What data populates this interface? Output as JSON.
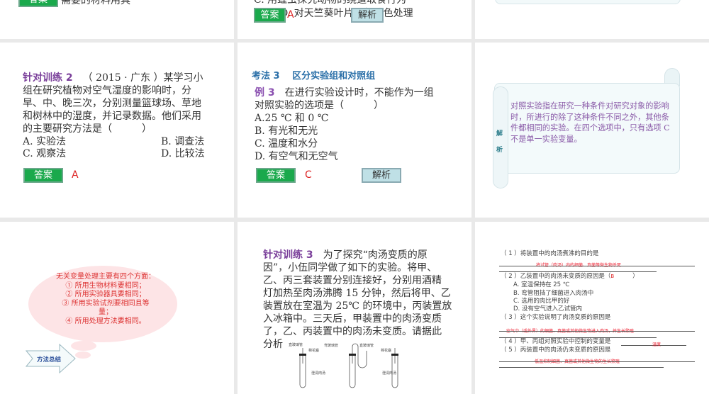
{
  "slides": {
    "s1": {
      "answer_label": "答案",
      "text": "需要的材料用具"
    },
    "s2": {
      "line_c": "C. 用蝗虫探究动物的绕道取食行为",
      "line_d": "D. 对天竺葵叶片进行暗色处理",
      "answer_label": "答案",
      "answer": "A",
      "analysis_label": "解析"
    },
    "s4": {
      "title": "针对训练 2",
      "source": "（ 2015 · 广东 ）某学习小",
      "lines": [
        "组在研究植物对空气湿度的影响时，分",
        "早、中、晚三次，分别测量篮球场、草地",
        "和树林中的湿度，并记录数据。他们采用",
        "的主要研究方法是（　　　）"
      ],
      "options": [
        "A. 实验法",
        "B. 调查法",
        "C. 观察法",
        "D. 比较法"
      ],
      "answer_label": "答案",
      "answer": "A"
    },
    "s5": {
      "heading": "考法 3　 区分实验组和对照组",
      "example": "例 3",
      "q_first": "　在进行实验设计时，不能作为一组",
      "lines": [
        "对照实验的选项是（　　　）",
        "A.25 ℃ 和 0 ℃",
        "B. 有光和无光",
        "C. 温度和水分",
        "D. 有空气和无空气"
      ],
      "answer_label": "答案",
      "answer": "C",
      "analysis_label": "解析"
    },
    "s6": {
      "tag": [
        "解",
        "析"
      ],
      "text": "对照实验指在研究一种条件对研究对象的影响时，所进行的除了这种条件不同之外，其他条件都相同的实验。在四个选项中，只有选项 C 不是单一实验变量。"
    },
    "s7": {
      "cloud_lines": [
        "无关变量处理主要有四个方面：",
        "① 所用生物材料要相同；",
        "② 所用实验器具要相同；",
        "③ 所用实验试剂要相同且等",
        "量；",
        "④ 所用处理方法要相同。"
      ],
      "arrow_label": "方法总结"
    },
    "s8": {
      "title": "针对训练 3",
      "first": "　为了探究“肉汤变质的原",
      "lines": [
        "因”，小伍同学做了如下的实验。将甲、",
        "乙、丙三套装置分别连接好，分别用酒精",
        "灯加热至肉汤沸腾 15 分钟，然后将甲、乙",
        "装置放在室温为 25℃ 的环境中，丙装置放",
        "入冰箱中。三天后，甲装置中的肉汤变质",
        "了，乙、丙装置中的肉汤未变质。请据此",
        "分析"
      ],
      "diagram_labels": {
        "straight_tube": "直玻璃管",
        "cotton": "棉花塞",
        "bent_tube": "弯玻璃管",
        "broth": "澄清肉汤"
      }
    },
    "s9": {
      "q1": "（ 1 ）将装置中的肉汤煮沸的目的是",
      "a1": "将试管（肉汤）内的细菌、真菌等微生物杀死",
      "q2": "（ 2 ）乙装置中的肉汤未变质的原因是（",
      "a2": "B",
      "q2_close": "）",
      "q2_opts": [
        "A. 室温保持在 25 ℃",
        "B. 弯管阻挡了细菌进入肉汤中",
        "C. 选用的肉比甲的好",
        "D. 没有空气进入乙试管内"
      ],
      "q3": "（ 3 ）这个实验说明了肉汤变质的原因是",
      "a3": "空气中（或外界）的细菌、真菌或其他微生物进入肉汤，并生长繁殖",
      "q4": "（ 4 ）甲、丙组对照实验中控制的变量是",
      "a4": "温度",
      "q5": "（ 5 ）丙装置中的肉汤仍未变质的原因是",
      "a5": "低温抑制细菌、真菌或其他微生物的生长繁殖"
    }
  }
}
